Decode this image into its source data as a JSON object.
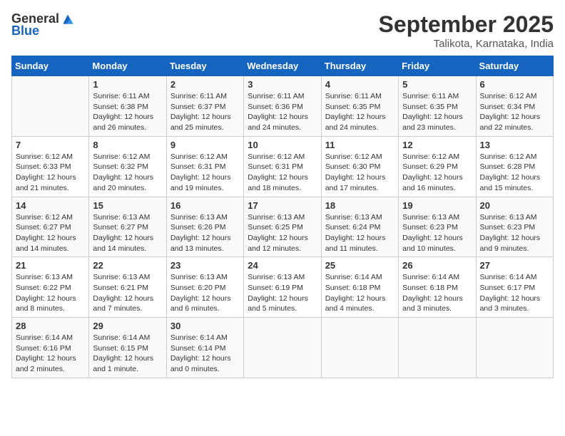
{
  "header": {
    "logo_general": "General",
    "logo_blue": "Blue",
    "month_year": "September 2025",
    "location": "Talikota, Karnataka, India"
  },
  "days_of_week": [
    "Sunday",
    "Monday",
    "Tuesday",
    "Wednesday",
    "Thursday",
    "Friday",
    "Saturday"
  ],
  "weeks": [
    [
      {
        "num": "",
        "info": ""
      },
      {
        "num": "1",
        "info": "Sunrise: 6:11 AM\nSunset: 6:38 PM\nDaylight: 12 hours\nand 26 minutes."
      },
      {
        "num": "2",
        "info": "Sunrise: 6:11 AM\nSunset: 6:37 PM\nDaylight: 12 hours\nand 25 minutes."
      },
      {
        "num": "3",
        "info": "Sunrise: 6:11 AM\nSunset: 6:36 PM\nDaylight: 12 hours\nand 24 minutes."
      },
      {
        "num": "4",
        "info": "Sunrise: 6:11 AM\nSunset: 6:35 PM\nDaylight: 12 hours\nand 24 minutes."
      },
      {
        "num": "5",
        "info": "Sunrise: 6:11 AM\nSunset: 6:35 PM\nDaylight: 12 hours\nand 23 minutes."
      },
      {
        "num": "6",
        "info": "Sunrise: 6:12 AM\nSunset: 6:34 PM\nDaylight: 12 hours\nand 22 minutes."
      }
    ],
    [
      {
        "num": "7",
        "info": "Sunrise: 6:12 AM\nSunset: 6:33 PM\nDaylight: 12 hours\nand 21 minutes."
      },
      {
        "num": "8",
        "info": "Sunrise: 6:12 AM\nSunset: 6:32 PM\nDaylight: 12 hours\nand 20 minutes."
      },
      {
        "num": "9",
        "info": "Sunrise: 6:12 AM\nSunset: 6:31 PM\nDaylight: 12 hours\nand 19 minutes."
      },
      {
        "num": "10",
        "info": "Sunrise: 6:12 AM\nSunset: 6:31 PM\nDaylight: 12 hours\nand 18 minutes."
      },
      {
        "num": "11",
        "info": "Sunrise: 6:12 AM\nSunset: 6:30 PM\nDaylight: 12 hours\nand 17 minutes."
      },
      {
        "num": "12",
        "info": "Sunrise: 6:12 AM\nSunset: 6:29 PM\nDaylight: 12 hours\nand 16 minutes."
      },
      {
        "num": "13",
        "info": "Sunrise: 6:12 AM\nSunset: 6:28 PM\nDaylight: 12 hours\nand 15 minutes."
      }
    ],
    [
      {
        "num": "14",
        "info": "Sunrise: 6:12 AM\nSunset: 6:27 PM\nDaylight: 12 hours\nand 14 minutes."
      },
      {
        "num": "15",
        "info": "Sunrise: 6:13 AM\nSunset: 6:27 PM\nDaylight: 12 hours\nand 14 minutes."
      },
      {
        "num": "16",
        "info": "Sunrise: 6:13 AM\nSunset: 6:26 PM\nDaylight: 12 hours\nand 13 minutes."
      },
      {
        "num": "17",
        "info": "Sunrise: 6:13 AM\nSunset: 6:25 PM\nDaylight: 12 hours\nand 12 minutes."
      },
      {
        "num": "18",
        "info": "Sunrise: 6:13 AM\nSunset: 6:24 PM\nDaylight: 12 hours\nand 11 minutes."
      },
      {
        "num": "19",
        "info": "Sunrise: 6:13 AM\nSunset: 6:23 PM\nDaylight: 12 hours\nand 10 minutes."
      },
      {
        "num": "20",
        "info": "Sunrise: 6:13 AM\nSunset: 6:23 PM\nDaylight: 12 hours\nand 9 minutes."
      }
    ],
    [
      {
        "num": "21",
        "info": "Sunrise: 6:13 AM\nSunset: 6:22 PM\nDaylight: 12 hours\nand 8 minutes."
      },
      {
        "num": "22",
        "info": "Sunrise: 6:13 AM\nSunset: 6:21 PM\nDaylight: 12 hours\nand 7 minutes."
      },
      {
        "num": "23",
        "info": "Sunrise: 6:13 AM\nSunset: 6:20 PM\nDaylight: 12 hours\nand 6 minutes."
      },
      {
        "num": "24",
        "info": "Sunrise: 6:13 AM\nSunset: 6:19 PM\nDaylight: 12 hours\nand 5 minutes."
      },
      {
        "num": "25",
        "info": "Sunrise: 6:14 AM\nSunset: 6:18 PM\nDaylight: 12 hours\nand 4 minutes."
      },
      {
        "num": "26",
        "info": "Sunrise: 6:14 AM\nSunset: 6:18 PM\nDaylight: 12 hours\nand 3 minutes."
      },
      {
        "num": "27",
        "info": "Sunrise: 6:14 AM\nSunset: 6:17 PM\nDaylight: 12 hours\nand 3 minutes."
      }
    ],
    [
      {
        "num": "28",
        "info": "Sunrise: 6:14 AM\nSunset: 6:16 PM\nDaylight: 12 hours\nand 2 minutes."
      },
      {
        "num": "29",
        "info": "Sunrise: 6:14 AM\nSunset: 6:15 PM\nDaylight: 12 hours\nand 1 minute."
      },
      {
        "num": "30",
        "info": "Sunrise: 6:14 AM\nSunset: 6:14 PM\nDaylight: 12 hours\nand 0 minutes."
      },
      {
        "num": "",
        "info": ""
      },
      {
        "num": "",
        "info": ""
      },
      {
        "num": "",
        "info": ""
      },
      {
        "num": "",
        "info": ""
      }
    ]
  ]
}
